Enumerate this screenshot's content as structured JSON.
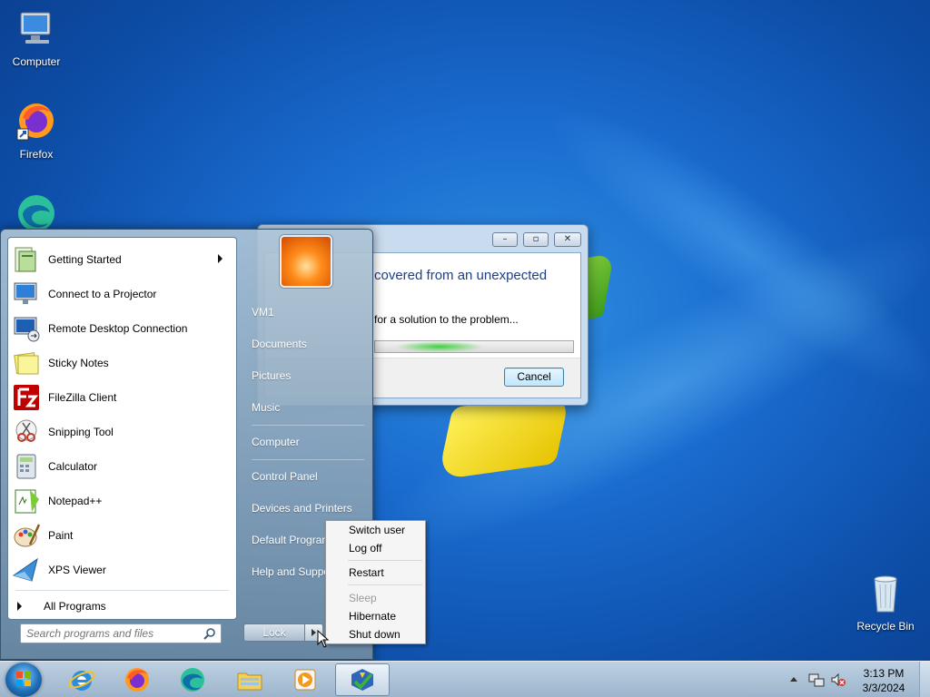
{
  "desktop": {
    "icons": [
      {
        "label": "Computer",
        "icon": "computer-icon"
      },
      {
        "label": "Firefox",
        "icon": "firefox-icon"
      },
      {
        "label": "",
        "icon": "edge-icon"
      },
      {
        "label": "Recycle Bin",
        "icon": "recycle-bin-icon"
      }
    ]
  },
  "dialog": {
    "heading": "covered from an unexpected",
    "status_text": "for a solution to the problem...",
    "cancel_label": "Cancel",
    "minimize_glyph": "–",
    "restore_glyph": "▫",
    "close_glyph": "✕"
  },
  "start_menu": {
    "programs": [
      {
        "label": "Getting Started",
        "icon": "getting-started-icon",
        "has_submenu": true
      },
      {
        "label": "Connect to a Projector",
        "icon": "projector-icon"
      },
      {
        "label": "Remote Desktop Connection",
        "icon": "remote-desktop-icon"
      },
      {
        "label": "Sticky Notes",
        "icon": "sticky-notes-icon"
      },
      {
        "label": "FileZilla Client",
        "icon": "filezilla-icon"
      },
      {
        "label": "Snipping Tool",
        "icon": "snipping-tool-icon"
      },
      {
        "label": "Calculator",
        "icon": "calculator-icon"
      },
      {
        "label": "Notepad++",
        "icon": "notepadpp-icon"
      },
      {
        "label": "Paint",
        "icon": "paint-icon"
      },
      {
        "label": "XPS Viewer",
        "icon": "xps-viewer-icon"
      }
    ],
    "all_programs": "All Programs",
    "search_placeholder": "Search programs and files",
    "right_items": [
      {
        "label": "VM1"
      },
      {
        "label": "Documents"
      },
      {
        "label": "Pictures"
      },
      {
        "label": "Music"
      },
      {
        "label": "Computer"
      },
      {
        "label": "Control Panel"
      },
      {
        "label": "Devices and Printers"
      },
      {
        "label": "Default Programs"
      },
      {
        "label": "Help and Support"
      }
    ],
    "lock_label": "Lock"
  },
  "power_menu": {
    "items": [
      {
        "label": "Switch user",
        "enabled": true
      },
      {
        "label": "Log off",
        "enabled": true
      },
      {
        "label": "Restart",
        "enabled": true
      },
      {
        "label": "Sleep",
        "enabled": false
      },
      {
        "label": "Hibernate",
        "enabled": true
      },
      {
        "label": "Shut down",
        "enabled": true
      }
    ]
  },
  "taskbar": {
    "pinned": [
      {
        "name": "internet-explorer-icon"
      },
      {
        "name": "firefox-icon"
      },
      {
        "name": "edge-icon"
      },
      {
        "name": "file-explorer-icon"
      },
      {
        "name": "media-player-icon"
      },
      {
        "name": "action-center-app-icon"
      }
    ],
    "clock_time": "3:13 PM",
    "clock_date": "3/3/2024"
  }
}
